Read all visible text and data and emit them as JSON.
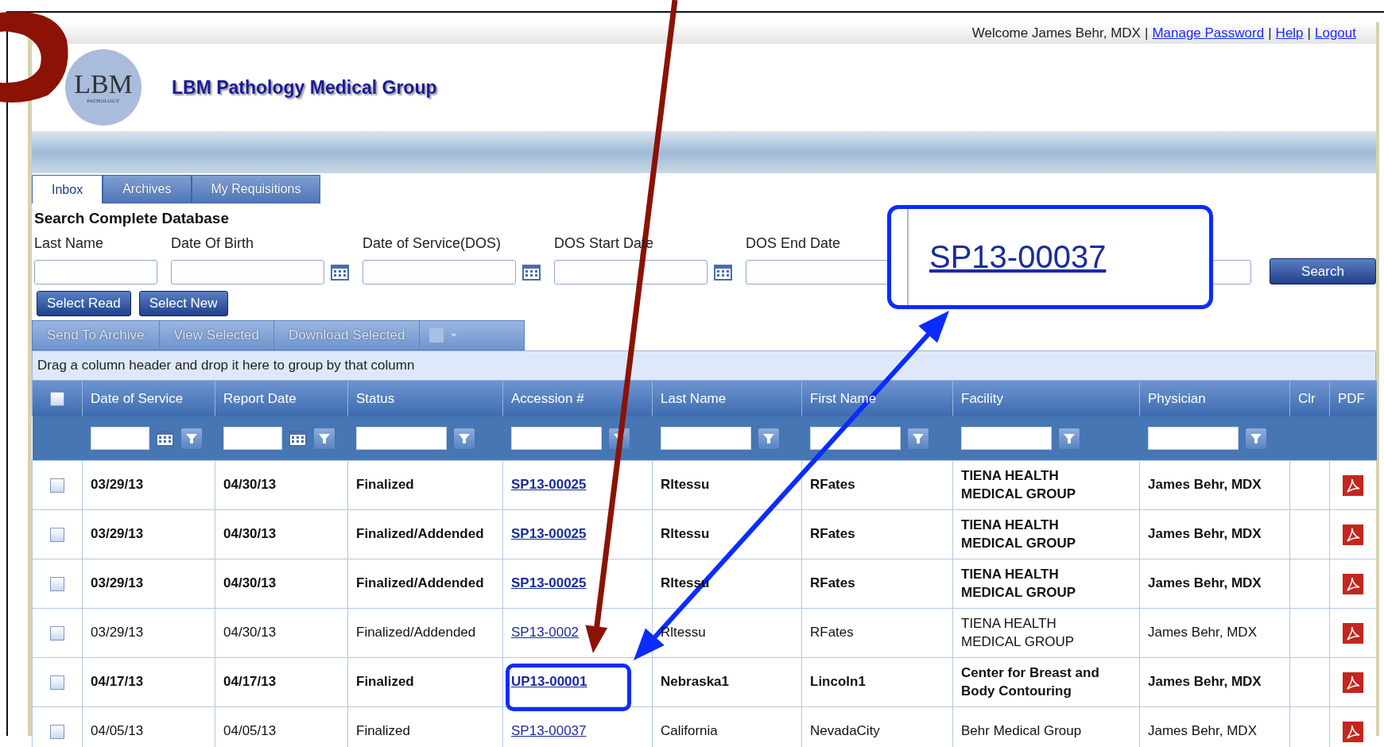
{
  "welcome_bar": [
    {
      "kind": "text",
      "text": "Welcome James Behr, MDX"
    },
    {
      "kind": "sep",
      "text": "|"
    },
    {
      "kind": "link",
      "text": "Manage Password"
    },
    {
      "kind": "sep",
      "text": "|"
    },
    {
      "kind": "link",
      "text": "Help"
    },
    {
      "kind": "sep",
      "text": "|"
    },
    {
      "kind": "link",
      "text": "Logout"
    }
  ],
  "logo": {
    "mark": "LBM",
    "subtitle": "PATHOLOGY"
  },
  "title": "LBM Pathology Medical Group",
  "tabs": [
    {
      "label": "Inbox",
      "selected": true
    },
    {
      "label": "Archives",
      "selected": false
    },
    {
      "label": "My Requisitions",
      "selected": false
    }
  ],
  "search": {
    "heading": "Search Complete Database",
    "fields": [
      {
        "label": "Last Name",
        "kind": "text"
      },
      {
        "label": "Date Of Birth",
        "kind": "date"
      },
      {
        "label": "Date of Service(DOS)",
        "kind": "date"
      },
      {
        "label": "DOS Start Date",
        "kind": "date"
      },
      {
        "label": "DOS End Date",
        "kind": "wide"
      }
    ],
    "button": "Search"
  },
  "select_buttons": [
    "Select Read",
    "Select New"
  ],
  "toolbar": [
    {
      "label": "Send To Archive",
      "disabled": true
    },
    {
      "label": "View Selected",
      "disabled": true
    },
    {
      "label": "Download Selected",
      "disabled": true
    }
  ],
  "group_hint": "Drag a column header and drop it here to group by that column",
  "table": {
    "select_all_checked": false,
    "columns": [
      {
        "label": "Date of Service",
        "kind": "text",
        "filter": true,
        "date_picker": true
      },
      {
        "label": "Report Date",
        "kind": "text",
        "filter": true,
        "date_picker": true
      },
      {
        "label": "Status",
        "kind": "text",
        "filter": true,
        "date_picker": false
      },
      {
        "label": "Accession #",
        "kind": "link",
        "filter": true,
        "date_picker": false
      },
      {
        "label": "Last Name",
        "kind": "text",
        "filter": true,
        "date_picker": false
      },
      {
        "label": "First Name",
        "kind": "text",
        "filter": true,
        "date_picker": false
      },
      {
        "label": "Facility",
        "kind": "text",
        "filter": true,
        "date_picker": false
      },
      {
        "label": "Physician",
        "kind": "text",
        "filter": true,
        "date_picker": false
      },
      {
        "label": "Clr",
        "kind": "empty",
        "filter": false
      },
      {
        "label": "PDF",
        "kind": "pdf",
        "filter": false
      }
    ],
    "rows": [
      {
        "checked": false,
        "unread": true,
        "cells": [
          "03/29/13",
          "04/30/13",
          "Finalized",
          "SP13-00025",
          "Rltessu",
          "RFates",
          "TIENA HEALTH MEDICAL GROUP",
          "James Behr, MDX"
        ]
      },
      {
        "checked": false,
        "unread": true,
        "cells": [
          "03/29/13",
          "04/30/13",
          "Finalized/Addended",
          "SP13-00025",
          "Rltessu",
          "RFates",
          "TIENA HEALTH MEDICAL GROUP",
          "James Behr, MDX"
        ]
      },
      {
        "checked": false,
        "unread": true,
        "cells": [
          "03/29/13",
          "04/30/13",
          "Finalized/Addended",
          "SP13-00025",
          "Rltessu",
          "RFates",
          "TIENA HEALTH MEDICAL GROUP",
          "James Behr, MDX"
        ]
      },
      {
        "checked": false,
        "unread": false,
        "cells": [
          "03/29/13",
          "04/30/13",
          "Finalized/Addended",
          "SP13-0002",
          "Rltessu",
          "RFates",
          "TIENA HEALTH MEDICAL GROUP",
          "James Behr, MDX"
        ]
      },
      {
        "checked": false,
        "unread": true,
        "cells": [
          "04/17/13",
          "04/17/13",
          "Finalized",
          "UP13-00001",
          "Nebraska1",
          "Lincoln1",
          "Center for Breast and Body Contouring",
          "James Behr, MDX"
        ]
      },
      {
        "checked": false,
        "unread": false,
        "cells": [
          "04/05/13",
          "04/05/13",
          "Finalized",
          "SP13-00037",
          "California",
          "NevadaCity",
          "Behr Medical Group",
          "James Behr, MDX"
        ]
      }
    ]
  },
  "callout": {
    "text": "SP13-00037"
  }
}
